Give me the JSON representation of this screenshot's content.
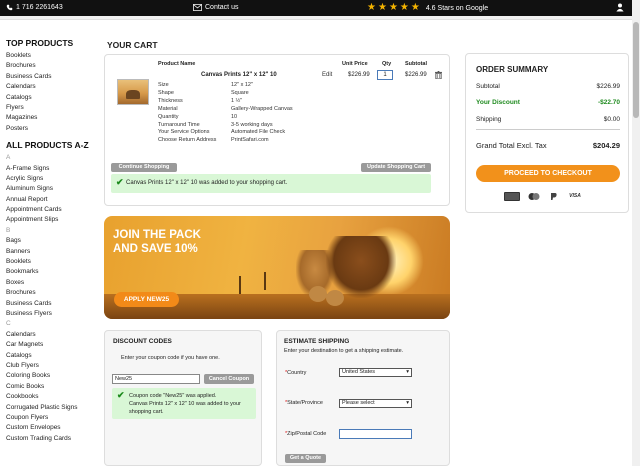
{
  "topbar": {
    "phone": "1 716 2261643",
    "contact": "Contact us",
    "rating_text": "4.6 Stars on Google",
    "stars": 5
  },
  "sidebar": {
    "top_heading": "TOP PRODUCTS",
    "top_items": [
      "Booklets",
      "Brochures",
      "Business Cards",
      "Calendars",
      "Catalogs",
      "Flyers",
      "Magazines",
      "Posters"
    ],
    "az_heading": "ALL PRODUCTS A-Z",
    "groups": [
      {
        "letter": "A",
        "items": [
          "A-Frame Signs",
          "Acrylic Signs",
          "Aluminum Signs",
          "Annual Report",
          "Appointment Cards",
          "Appointment Slips"
        ]
      },
      {
        "letter": "B",
        "items": [
          "Bags",
          "Banners",
          "Booklets",
          "Bookmarks",
          "Boxes",
          "Brochures",
          "Business Cards",
          "Business Flyers"
        ]
      },
      {
        "letter": "C",
        "items": [
          "Calendars",
          "Car Magnets",
          "Catalogs",
          "Club Flyers",
          "Coloring Books",
          "Comic Books",
          "Cookbooks",
          "Corrugated Plastic Signs",
          "Coupon Flyers",
          "Custom Envelopes",
          "Custom Trading Cards"
        ]
      }
    ]
  },
  "cart": {
    "title": "YOUR CART",
    "headers": {
      "product": "Product Name",
      "unit_price": "Unit Price",
      "qty": "Qty",
      "subtotal": "Subtotal"
    },
    "product_name": "Canvas Prints 12\" x 12\" 10",
    "options": [
      {
        "label": "Size",
        "value": "12\" x 12\""
      },
      {
        "label": "Shape",
        "value": "Square"
      },
      {
        "label": "Thickness",
        "value": "1 ½\""
      },
      {
        "label": "Material",
        "value": "Gallery-Wrapped Canvas"
      },
      {
        "label": "Quantity",
        "value": "10"
      },
      {
        "label": "Turnaround Time",
        "value": "3-5 working days"
      },
      {
        "label": "Your Service Options",
        "value": "Automated File Check"
      },
      {
        "label": "Choose Return Address",
        "value": "PrintSafari.com"
      }
    ],
    "edit": "Edit",
    "unit_price": "$226.99",
    "qty": "1",
    "subtotal": "$226.99",
    "continue_label": "Continue Shopping",
    "update_label": "Update Shopping Cart",
    "success_msg": "Canvas Prints 12\" x 12\" 10 was added to your shopping cart."
  },
  "banner": {
    "line1": "JOIN THE PACK",
    "line2": "AND SAVE 10%",
    "cta": "APPLY NEW25"
  },
  "coupon": {
    "title": "DISCOUNT CODES",
    "instruction": "Enter your coupon code if you have one.",
    "input_value": "New25",
    "cancel_label": "Cancel Coupon",
    "msg_line1": "Coupon code \"New25\" was applied.",
    "msg_line2": "Canvas Prints 12\" x 12\" 10 was added to your",
    "msg_line3": "shopping cart."
  },
  "shipping": {
    "title": "ESTIMATE SHIPPING",
    "instruction": "Enter your destination to get a shipping estimate.",
    "country_label": "Country",
    "country_value": "United States",
    "state_label": "State/Province",
    "state_value": "Please select",
    "zip_label": "Zip/Postal Code",
    "zip_value": "",
    "quote_label": "Get a Quote",
    "required_mark": "*"
  },
  "summary": {
    "title": "ORDER SUMMARY",
    "rows": [
      {
        "label": "Subtotal",
        "value": "$226.99"
      },
      {
        "label": "Your Discount",
        "value": "-$22.70"
      },
      {
        "label": "Shipping",
        "value": "$0.00"
      }
    ],
    "total_label": "Grand Total Excl. Tax",
    "total_value": "$204.29",
    "checkout_label": "PROCEED TO CHECKOUT",
    "payment_icons": [
      "credit-card-icon",
      "mastercard-icon",
      "paypal-icon",
      "visa-icon"
    ],
    "visa_text": "VISA"
  },
  "colors": {
    "accent": "#f2911b",
    "success_bg": "#d9f7d6",
    "discount_green": "#1e8a1e"
  }
}
